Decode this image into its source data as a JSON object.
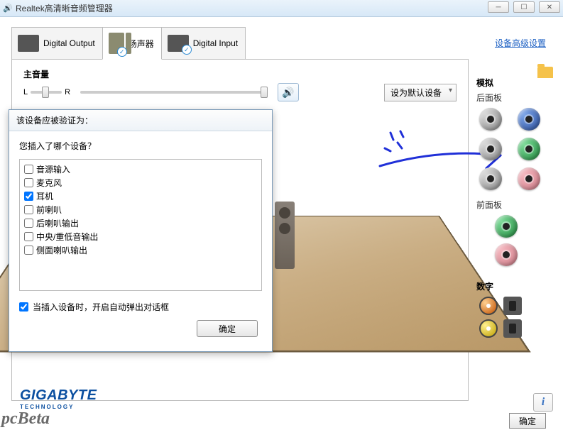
{
  "window": {
    "title": "Realtek高清晰音频管理器"
  },
  "tabs": {
    "digital_output": "Digital Output",
    "speakers": "扬声器",
    "digital_input": "Digital Input"
  },
  "volume": {
    "label": "主音量",
    "left": "L",
    "right": "R"
  },
  "default_device": {
    "label": "设为默认设备"
  },
  "advanced_link": "设备高级设置",
  "side": {
    "analog": "模拟",
    "rear": "后面板",
    "front": "前面板",
    "digital": "数字"
  },
  "dialog": {
    "title": "该设备应被验证为：",
    "question": "您插入了哪个设备？",
    "items": [
      {
        "label": "音源输入",
        "checked": false
      },
      {
        "label": "麦克风",
        "checked": false
      },
      {
        "label": "耳机",
        "checked": true
      },
      {
        "label": "前喇叭",
        "checked": false
      },
      {
        "label": "后喇叭输出",
        "checked": false
      },
      {
        "label": "中央/重低音输出",
        "checked": false
      },
      {
        "label": "侧面喇叭输出",
        "checked": false
      }
    ],
    "auto_popup": "当插入设备时，开启自动弹出对话框",
    "auto_popup_checked": true,
    "ok": "确定"
  },
  "brand": {
    "name": "GIGABYTE",
    "sub": "TECHNOLOGY"
  },
  "watermark": "pcBeta",
  "footer_ok": "确定"
}
